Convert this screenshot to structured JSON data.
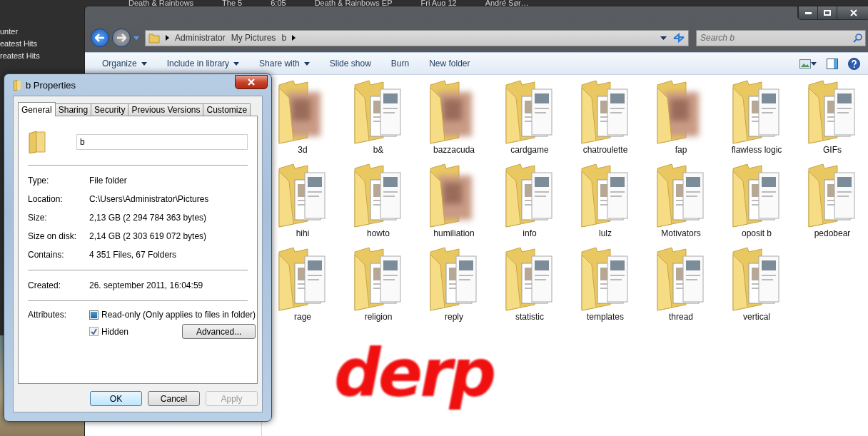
{
  "background_player": {
    "now_playing": [
      "Death & Rainbows",
      "The 5",
      "6:05",
      "Death & Rainbows EP",
      "Fri Aug 12",
      "André Sør…"
    ],
    "sidebar": [
      "unter",
      "eatest Hits",
      "reatest Hits"
    ]
  },
  "explorer": {
    "breadcrumbs": [
      "Administrator",
      "My Pictures",
      "b"
    ],
    "search": {
      "placeholder": "Search b"
    },
    "toolbar": [
      {
        "label": "Organize",
        "dropdown": true
      },
      {
        "label": "Include in library",
        "dropdown": true
      },
      {
        "label": "Share with",
        "dropdown": true
      },
      {
        "label": "Slide show",
        "dropdown": false
      },
      {
        "label": "Burn",
        "dropdown": false
      },
      {
        "label": "New folder",
        "dropdown": false
      }
    ],
    "folders": [
      {
        "name": "3d",
        "kind": "blurred"
      },
      {
        "name": "b&",
        "kind": "pages"
      },
      {
        "name": "bazzacuda",
        "kind": "blurred"
      },
      {
        "name": "cardgame",
        "kind": "pages"
      },
      {
        "name": "chatroulette",
        "kind": "pages"
      },
      {
        "name": "fap",
        "kind": "blurred"
      },
      {
        "name": "flawless logic",
        "kind": "pages"
      },
      {
        "name": "GIFs",
        "kind": "pages"
      },
      {
        "name": "hihi",
        "kind": "pages"
      },
      {
        "name": "howto",
        "kind": "pages"
      },
      {
        "name": "humiliation",
        "kind": "blurred"
      },
      {
        "name": "info",
        "kind": "pages"
      },
      {
        "name": "lulz",
        "kind": "pages"
      },
      {
        "name": "Motivators",
        "kind": "pages"
      },
      {
        "name": "oposit b",
        "kind": "pages"
      },
      {
        "name": "pedobear",
        "kind": "pages"
      },
      {
        "name": "rage",
        "kind": "pages"
      },
      {
        "name": "religion",
        "kind": "pages"
      },
      {
        "name": "reply",
        "kind": "pages"
      },
      {
        "name": "statistic",
        "kind": "pages"
      },
      {
        "name": "templates",
        "kind": "pages"
      },
      {
        "name": "thread",
        "kind": "pages"
      },
      {
        "name": "vertical",
        "kind": "pages"
      }
    ]
  },
  "dialog": {
    "title": "b Properties",
    "tabs": [
      {
        "label": "General",
        "selected": true
      },
      {
        "label": "Sharing",
        "selected": false
      },
      {
        "label": "Security",
        "selected": false
      },
      {
        "label": "Previous Versions",
        "selected": false
      },
      {
        "label": "Customize",
        "selected": false
      }
    ],
    "name_value": "b",
    "sections": [
      [
        {
          "label": "Type:",
          "value": "File folder"
        },
        {
          "label": "Location:",
          "value": "C:\\Users\\Administrator\\Pictures"
        },
        {
          "label": "Size:",
          "value": "2,13 GB (2 294 784 363 bytes)"
        },
        {
          "label": "Size on disk:",
          "value": "2,14 GB (2 303 619 072 bytes)"
        },
        {
          "label": "Contains:",
          "value": "4 351 Files, 67 Folders"
        }
      ],
      [
        {
          "label": "Created:",
          "value": "26. september 2011, 16:04:59"
        }
      ]
    ],
    "attributes_label": "Attributes:",
    "attributes": [
      {
        "label": "Read-only (Only applies to files in folder)",
        "checked": false,
        "indeterminate": true
      },
      {
        "label": "Hidden",
        "checked": true,
        "indeterminate": false
      }
    ],
    "advanced_button": "Advanced...",
    "buttons": [
      {
        "label": "OK",
        "default": true,
        "disabled": false
      },
      {
        "label": "Cancel",
        "default": false,
        "disabled": false
      },
      {
        "label": "Apply",
        "default": false,
        "disabled": true
      }
    ]
  },
  "annotation": {
    "text": "derp"
  }
}
